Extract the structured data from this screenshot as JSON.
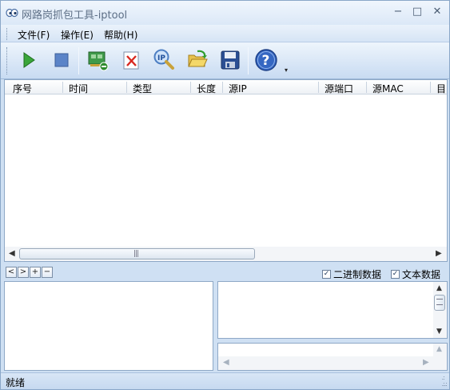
{
  "window": {
    "title": "网路岗抓包工具-iptool",
    "minimize_glyph": "−",
    "maximize_glyph": "□",
    "close_glyph": "✕"
  },
  "menu": {
    "items": [
      {
        "label": "文件(F)"
      },
      {
        "label": "操作(E)"
      },
      {
        "label": "帮助(H)"
      }
    ]
  },
  "toolbar": {
    "buttons": [
      {
        "name": "start-capture",
        "icon": "play-icon"
      },
      {
        "name": "stop-capture",
        "icon": "stop-icon"
      },
      {
        "name": "network-adapter",
        "icon": "network-card-icon"
      },
      {
        "name": "clear",
        "icon": "clear-icon"
      },
      {
        "name": "ip-search",
        "icon": "ip-magnifier-icon"
      },
      {
        "name": "open-file",
        "icon": "open-folder-icon"
      },
      {
        "name": "save-file",
        "icon": "save-icon"
      },
      {
        "name": "help",
        "icon": "help-icon"
      }
    ]
  },
  "packet_list": {
    "columns": [
      "序号",
      "时间",
      "类型",
      "长度",
      "源IP",
      "源端口",
      "源MAC",
      "目"
    ],
    "rows": []
  },
  "nav": {
    "prev": "<",
    "next": ">",
    "expand": "+",
    "collapse": "−"
  },
  "options": {
    "binary_label": "二进制数据",
    "binary_checked": true,
    "text_label": "文本数据",
    "text_checked": true
  },
  "status": {
    "text": "就绪"
  },
  "colors": {
    "window_bg": "#cfe0f3",
    "accent": "#3a66b8",
    "play": "#2f9e2f",
    "stop": "#5b84c8"
  }
}
